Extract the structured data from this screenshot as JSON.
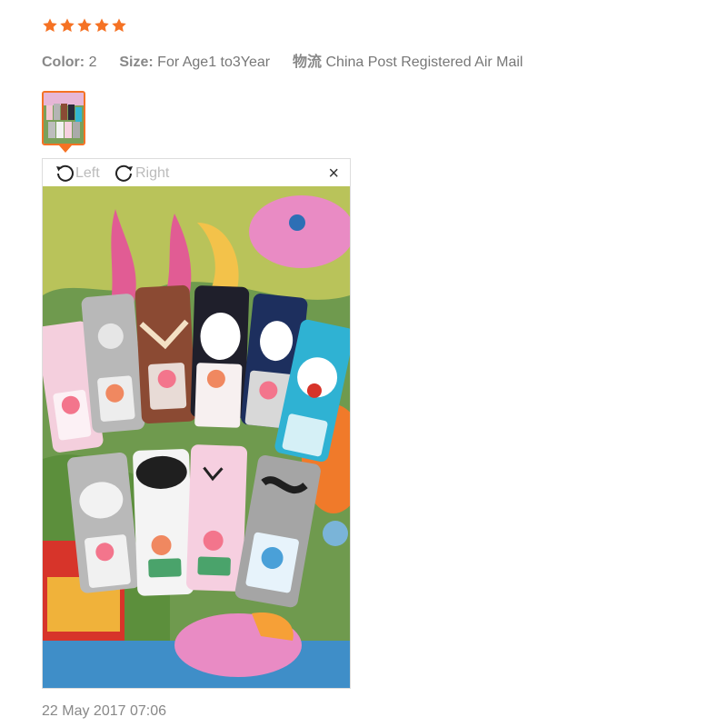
{
  "review": {
    "rating": 5,
    "star_color": "#f57224",
    "color_key": "Color:",
    "color_value": "2",
    "size_key": "Size:",
    "size_value": "For Age1 to3Year",
    "shipping_key": "物流",
    "shipping_value": "China Post Registered Air Mail",
    "date": "22 May 2017 07:06"
  },
  "viewer": {
    "rotate_left_label": "Left",
    "rotate_right_label": "Right",
    "close_label": "×",
    "thumbnail_selected": true
  }
}
